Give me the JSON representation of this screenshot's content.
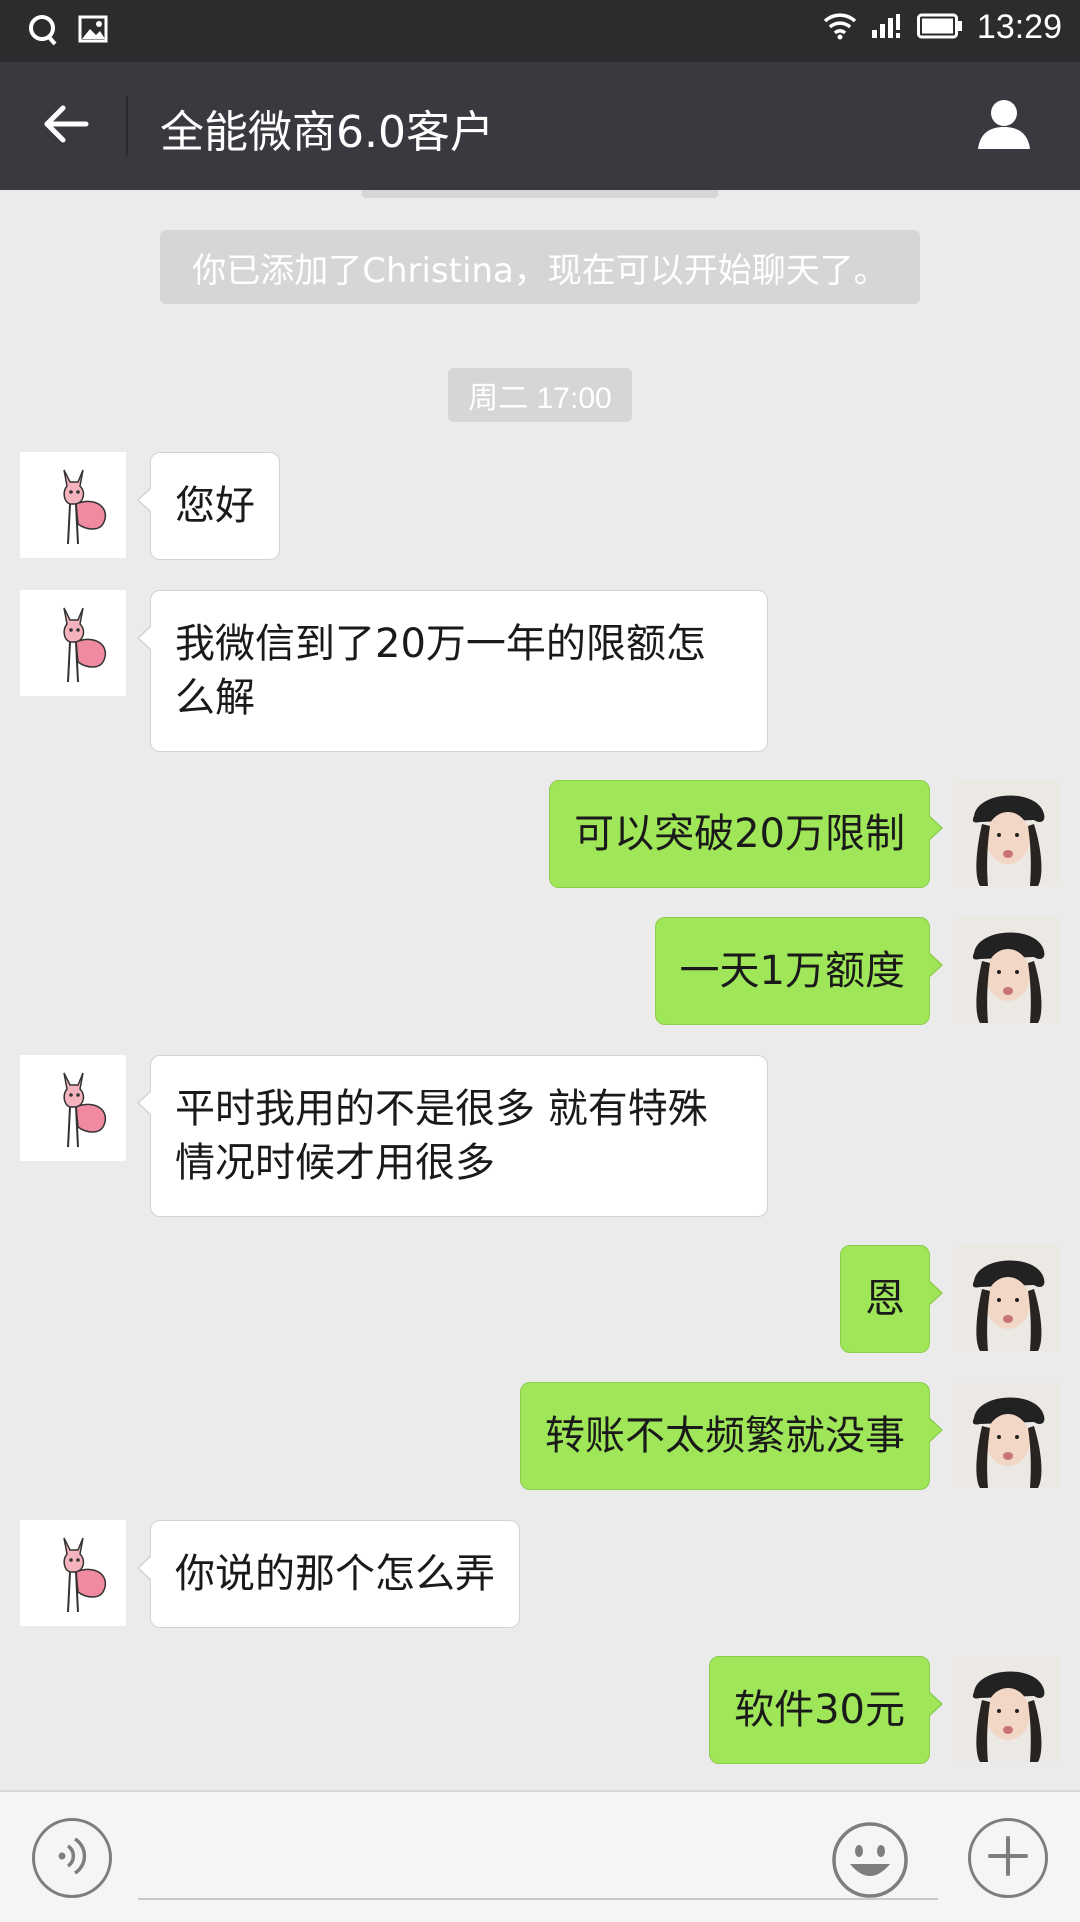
{
  "status_bar": {
    "time": "13:29"
  },
  "header": {
    "title": "全能微商6.0客户"
  },
  "chat": {
    "system_message": "你已添加了Christina，现在可以开始聊天了。",
    "timestamp": "周二 17:00",
    "messages": [
      {
        "side": "in",
        "text": "您好"
      },
      {
        "side": "in",
        "text": "我微信到了20万一年的限额怎么解"
      },
      {
        "side": "out",
        "text": "可以突破20万限制"
      },
      {
        "side": "out",
        "text": "一天1万额度"
      },
      {
        "side": "in",
        "text": "平时我用的不是很多 就有特殊情况时候才用很多"
      },
      {
        "side": "out",
        "text": "恩"
      },
      {
        "side": "out",
        "text": "转账不太频繁就没事"
      },
      {
        "side": "in",
        "text": "你说的那个怎么弄"
      },
      {
        "side": "out",
        "text": "软件30元"
      }
    ]
  },
  "input_bar": {
    "value": ""
  },
  "icons": {
    "status_left": [
      "qq-icon",
      "image-icon"
    ],
    "status_right": [
      "wifi-icon",
      "signal-icon",
      "battery-icon"
    ],
    "header_left": "back-arrow-icon",
    "header_right": "profile-icon",
    "input_left": "voice-icon",
    "input_right": [
      "emoji-icon",
      "plus-icon"
    ]
  },
  "colors": {
    "titlebar": "#393a3f",
    "statusbar": "#2b2c2e",
    "chat_bg": "#ebebeb",
    "outgoing_bubble": "#9fe658",
    "incoming_bubble": "#ffffff"
  }
}
